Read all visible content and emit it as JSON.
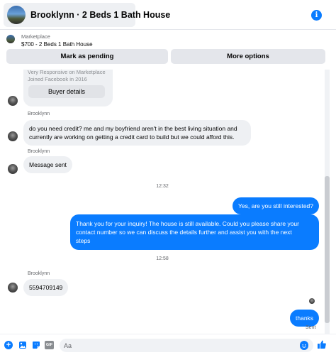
{
  "header": {
    "title": "Brooklynn · 2 Beds 1 Bath House",
    "info_icon": "info-icon",
    "info_glyph": "i"
  },
  "marketplace": {
    "label": "Marketplace",
    "listing": "$700 - 2 Beds 1 Bath House",
    "mark_pending_label": "Mark as pending",
    "more_options_label": "More options"
  },
  "chat": {
    "profile_card": {
      "line1": "Very Responsive on Marketplace",
      "line2": "Joined Facebook in 2016",
      "buyer_details_label": "Buyer details"
    },
    "messages": [
      {
        "sender": "Brooklynn",
        "text_line1": "do you need credit? me and my boyfriend aren't in the best living situation and",
        "text_line2": "currently are working on getting a credit card to build but we could afford this."
      },
      {
        "sender": "Brooklynn",
        "text": "Message sent"
      },
      {
        "timestamp": "12:32"
      },
      {
        "outgoing": true,
        "text": "Yes, are you still interested?"
      },
      {
        "outgoing": true,
        "text_line1": "Thank you for your inquiry! The house is still available. Could you please share your",
        "text_line2": "contact number so we can discuss the details further and assist you with the next",
        "text_line3": "steps"
      },
      {
        "timestamp": "12:58"
      },
      {
        "sender": "Brooklynn",
        "text": "5594709149"
      },
      {
        "outgoing": true,
        "text": "thanks"
      }
    ],
    "status": "Sent"
  },
  "composer": {
    "placeholder": "Aa",
    "gif_label": "GIF",
    "plus_glyph": "+"
  },
  "colors": {
    "accent": "#0a7cff",
    "incoming_bubble": "#eef0f3",
    "button_bg": "#e4e6eb"
  }
}
